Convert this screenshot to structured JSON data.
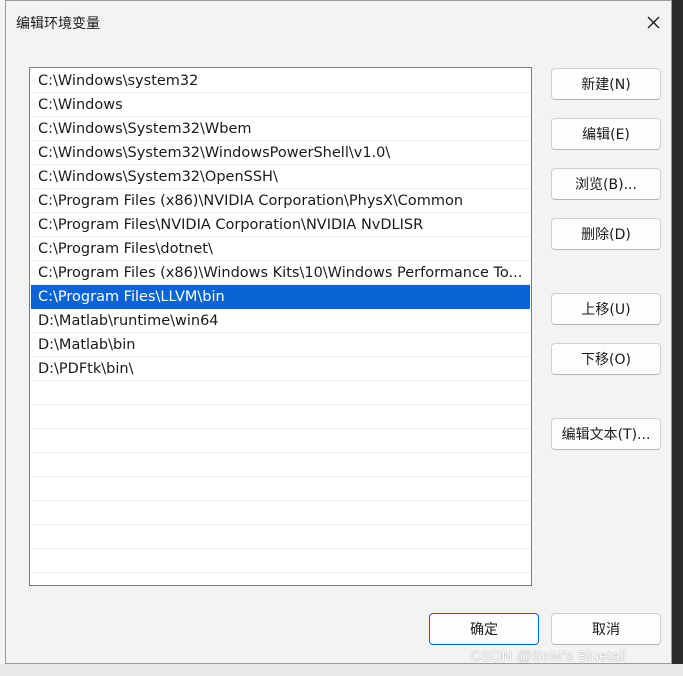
{
  "dialog": {
    "title": "编辑环境变量"
  },
  "paths": [
    "C:\\Windows\\system32",
    "C:\\Windows",
    "C:\\Windows\\System32\\Wbem",
    "C:\\Windows\\System32\\WindowsPowerShell\\v1.0\\",
    "C:\\Windows\\System32\\OpenSSH\\",
    "C:\\Program Files (x86)\\NVIDIA Corporation\\PhysX\\Common",
    "C:\\Program Files\\NVIDIA Corporation\\NVIDIA NvDLISR",
    "C:\\Program Files\\dotnet\\",
    "C:\\Program Files (x86)\\Windows Kits\\10\\Windows Performance To...",
    "C:\\Program Files\\LLVM\\bin",
    "D:\\Matlab\\runtime\\win64",
    "D:\\Matlab\\bin",
    "D:\\PDFtk\\bin\\"
  ],
  "selected_index": 9,
  "buttons": {
    "new": "新建(N)",
    "edit": "编辑(E)",
    "browse": "浏览(B)...",
    "delete": "删除(D)",
    "move_up": "上移(U)",
    "move_down": "下移(O)",
    "edit_text": "编辑文本(T)...",
    "ok": "确定",
    "cancel": "取消"
  },
  "watermark": "CSDN @SoM's Bluetail",
  "colors": {
    "selection": "#0a64d6",
    "dialog_bg": "#f3f3f3"
  }
}
